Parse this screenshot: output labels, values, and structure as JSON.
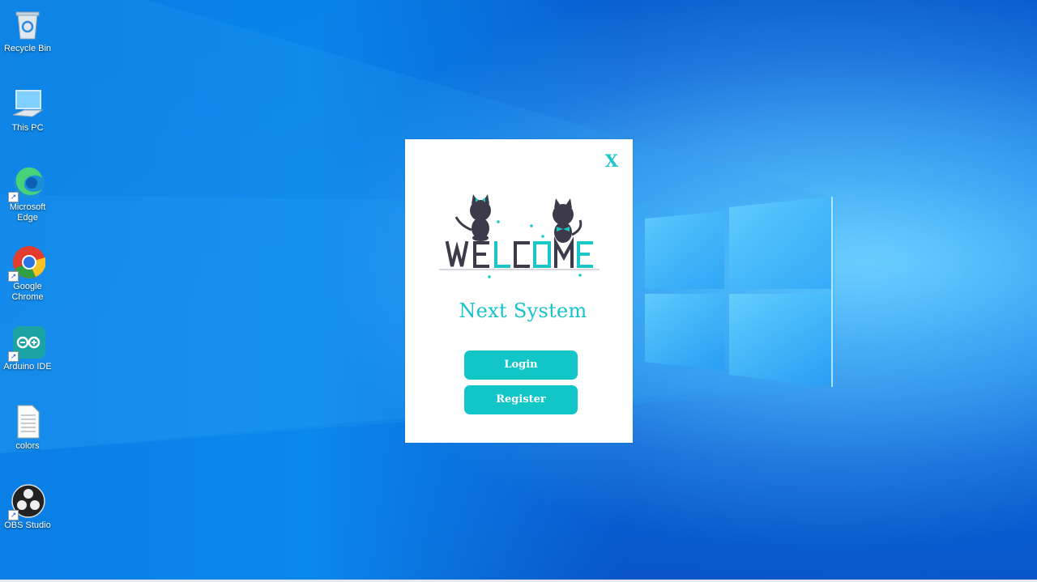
{
  "desktop": {
    "icons": [
      {
        "label": "Recycle Bin",
        "icon": "recycle-bin-icon"
      },
      {
        "label": "This PC",
        "icon": "computer-icon"
      },
      {
        "label": "Microsoft Edge",
        "icon": "edge-icon"
      },
      {
        "label": "Google Chrome",
        "icon": "chrome-icon"
      },
      {
        "label": "Arduino IDE",
        "icon": "arduino-icon"
      },
      {
        "label": "colors",
        "icon": "text-file-icon"
      },
      {
        "label": "OBS Studio",
        "icon": "obs-icon"
      }
    ]
  },
  "dialog": {
    "close_label": "X",
    "title": "Next System",
    "login_label": "Login",
    "register_label": "Register",
    "welcome_text": "WELCOME"
  },
  "colors": {
    "accent": "#12c6c8",
    "desktop_blue": "#0a6fdc"
  }
}
